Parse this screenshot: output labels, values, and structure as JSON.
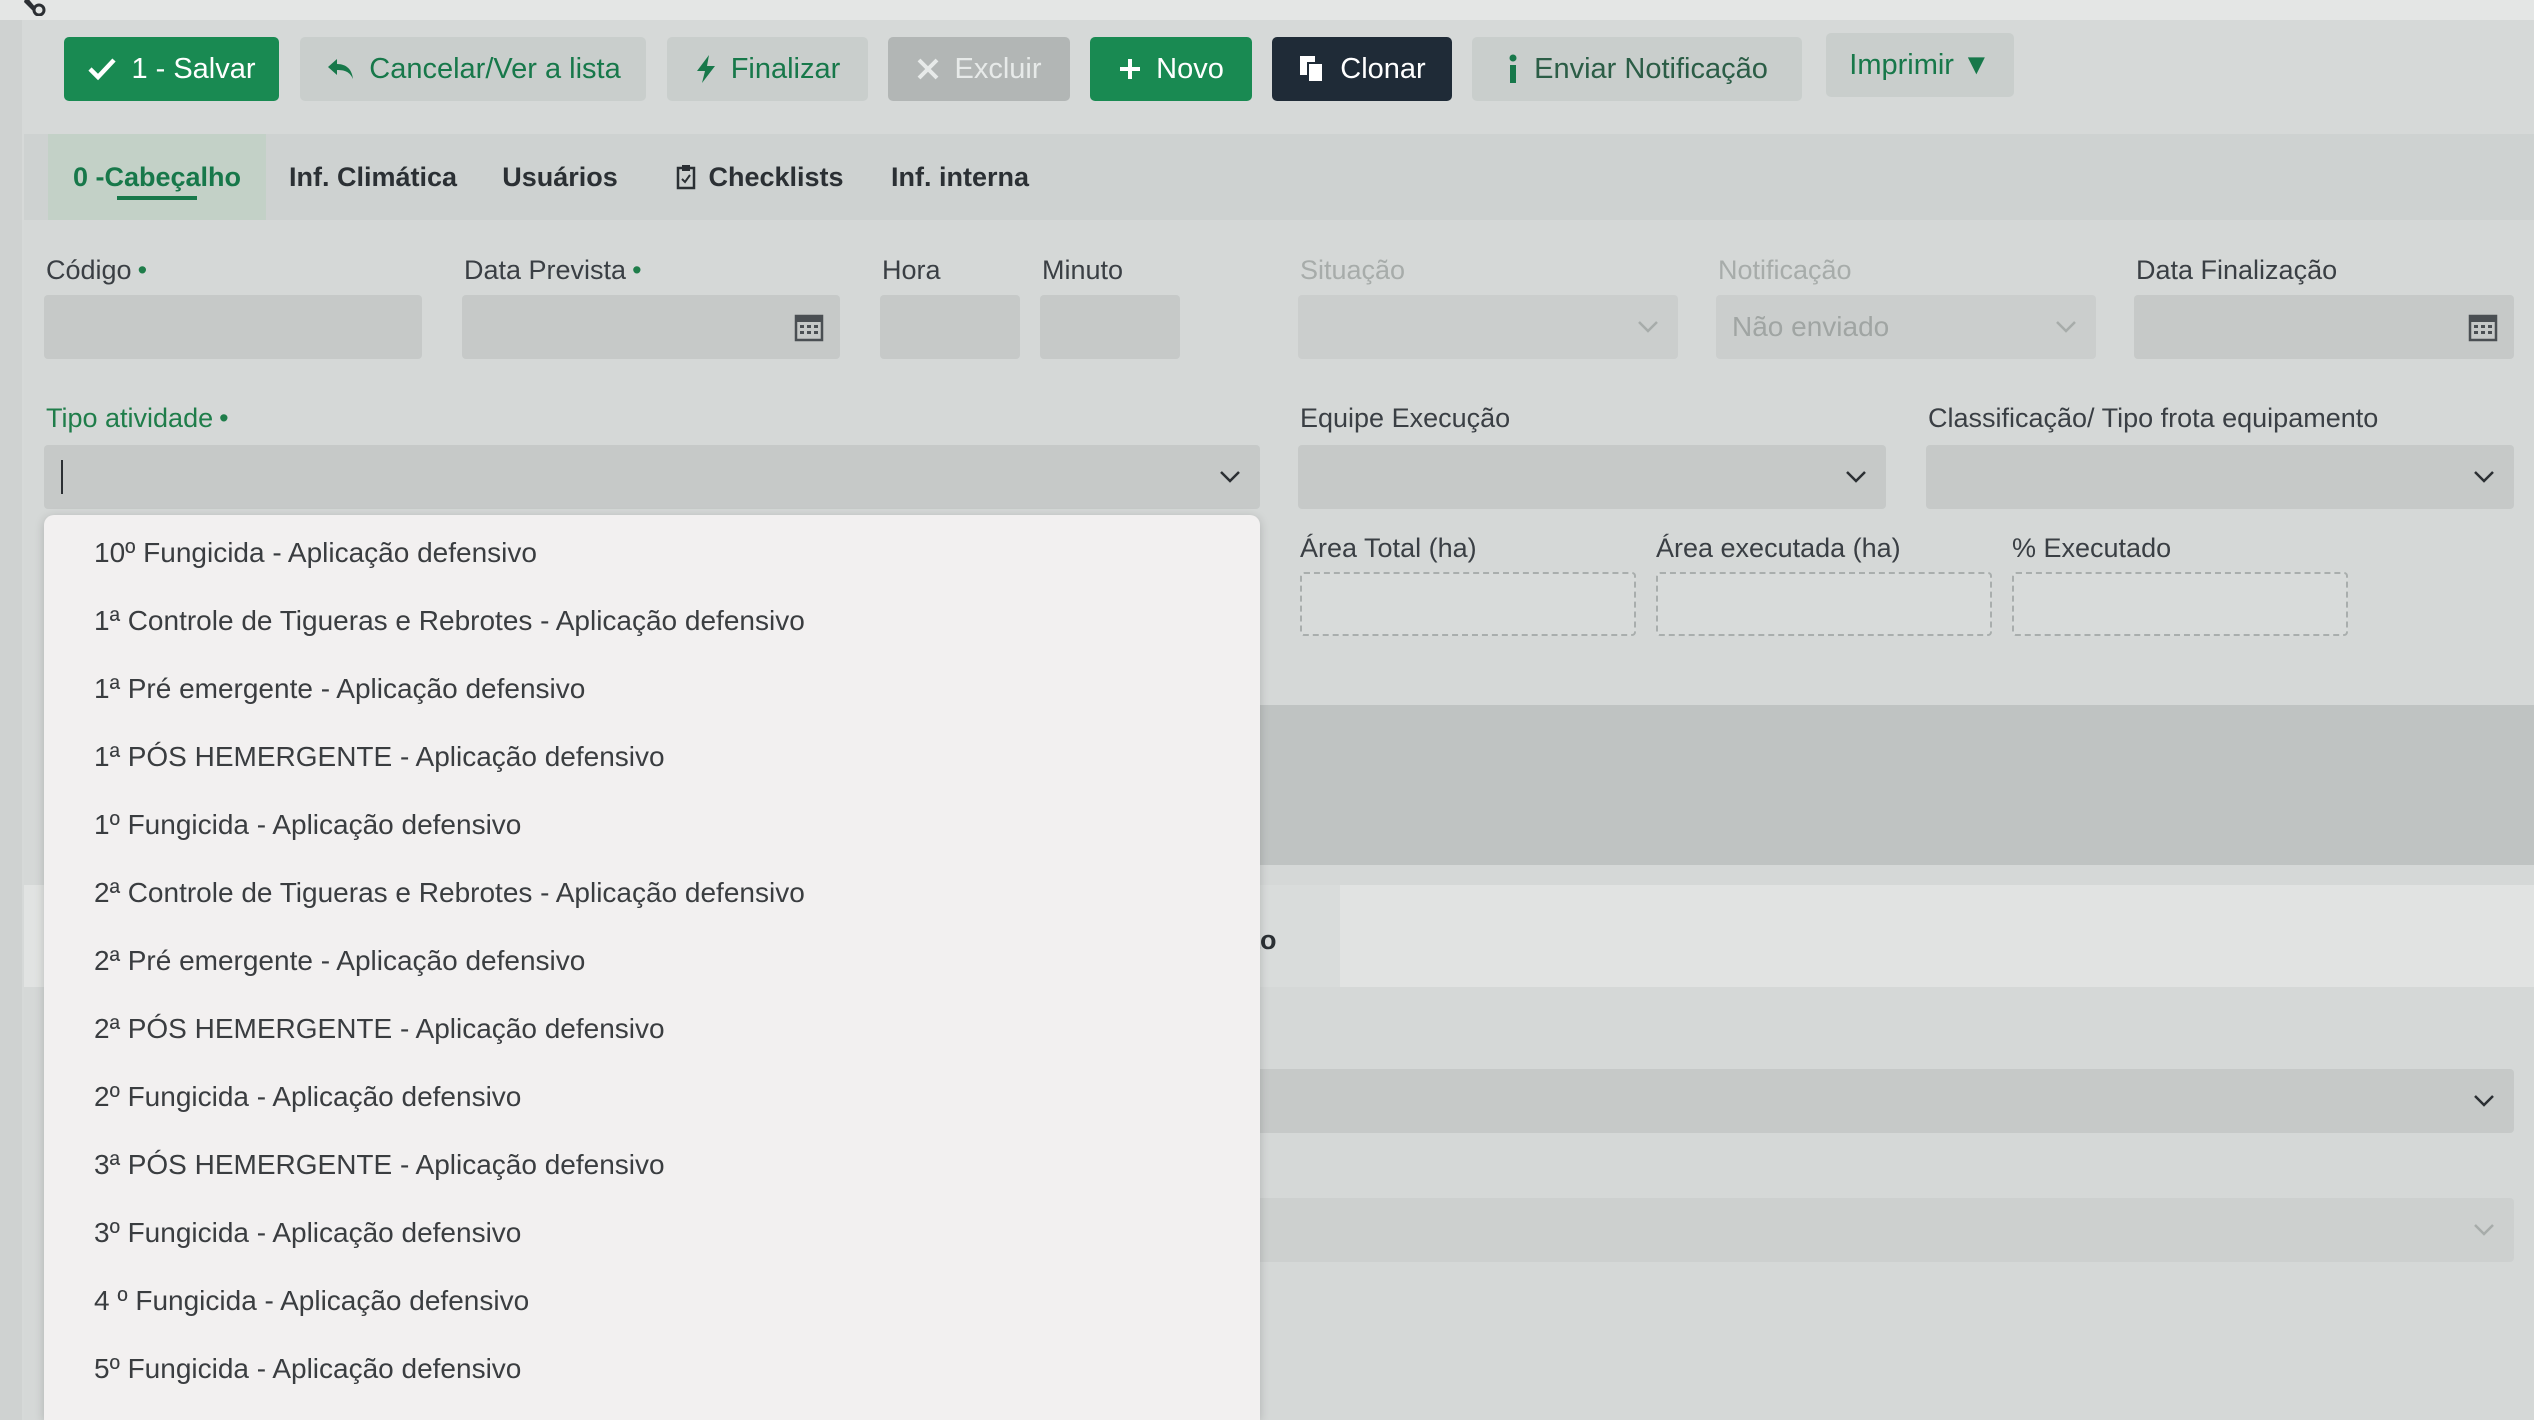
{
  "toolbar": {
    "save": "1 - Salvar",
    "cancel": "Cancelar/Ver a lista",
    "finish": "Finalizar",
    "delete": "Excluir",
    "new": "Novo",
    "clone": "Clonar",
    "notify": "Enviar Notificação",
    "print": "Imprimir ▼"
  },
  "tabs": [
    {
      "label": "0 -Cabeçalho",
      "active": true
    },
    {
      "label": "Inf. Climática"
    },
    {
      "label": "Usuários"
    },
    {
      "label": "Checklists"
    },
    {
      "label": "Inf. interna"
    }
  ],
  "form": {
    "codigo": {
      "label": "Código",
      "value": ""
    },
    "data_prevista": {
      "label": "Data Prevista",
      "value": ""
    },
    "hora": {
      "label": "Hora",
      "value": ""
    },
    "minuto": {
      "label": "Minuto",
      "value": ""
    },
    "situacao": {
      "label": "Situação",
      "value": ""
    },
    "notificacao": {
      "label": "Notificação",
      "value": "Não enviado"
    },
    "data_finalizacao": {
      "label": "Data Finalização",
      "value": ""
    },
    "tipo_atividade": {
      "label": "Tipo atividade",
      "value": ""
    },
    "equipe_execucao": {
      "label": "Equipe Execução",
      "value": ""
    },
    "classificacao": {
      "label": "Classificação/ Tipo frota equipamento",
      "value": ""
    },
    "area_total": {
      "label": "Área Total (ha)",
      "value": ""
    },
    "area_executada": {
      "label": "Área executada (ha)",
      "value": ""
    },
    "pct_executado": {
      "label": "% Executado",
      "value": ""
    }
  },
  "required_marker": "•",
  "lower_tab_fragment": "ão",
  "dropdown_options": [
    "10º Fungicida - Aplicação defensivo",
    "1ª Controle de Tigueras e Rebrotes - Aplicação defensivo",
    "1ª Pré emergente - Aplicação defensivo",
    "1ª PÓS HEMERGENTE - Aplicação defensivo",
    "1º Fungicida - Aplicação defensivo",
    "2ª Controle de Tigueras e Rebrotes - Aplicação defensivo",
    "2ª Pré emergente - Aplicação defensivo",
    "2ª PÓS HEMERGENTE - Aplicação defensivo",
    "2º Fungicida - Aplicação defensivo",
    "3ª PÓS HEMERGENTE - Aplicação defensivo",
    "3º Fungicida - Aplicação defensivo",
    "4 º Fungicida - Aplicação defensivo",
    "5º Fungicida - Aplicação defensivo"
  ],
  "colors": {
    "primary_green": "#198a52",
    "dark_button": "#1f2b37",
    "accent_text_green": "#17784a"
  }
}
